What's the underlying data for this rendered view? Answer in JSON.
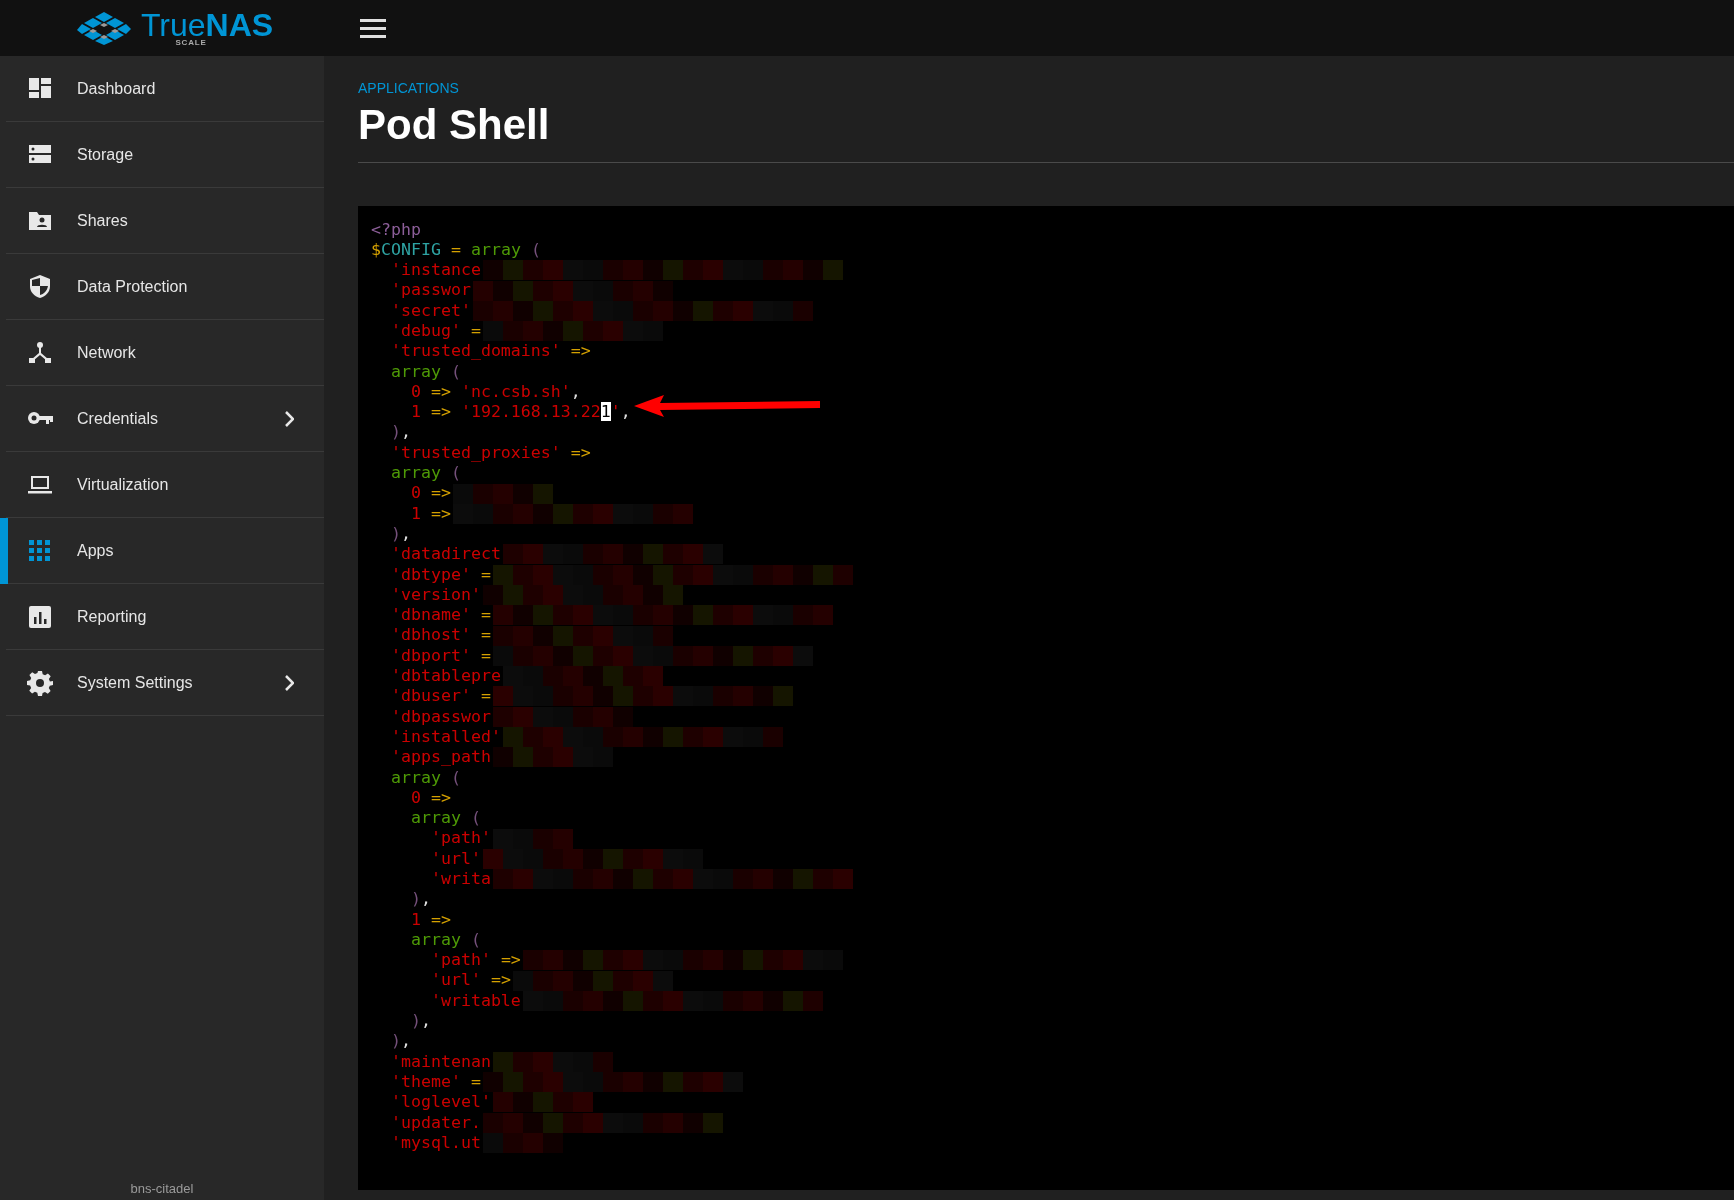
{
  "header": {
    "logo_text": "True**NAS**",
    "logo_subtitle": "SCALE"
  },
  "sidebar": {
    "items": [
      {
        "label": "Dashboard",
        "selected": false,
        "has_submenu": false
      },
      {
        "label": "Storage",
        "selected": false,
        "has_submenu": false
      },
      {
        "label": "Shares",
        "selected": false,
        "has_submenu": false
      },
      {
        "label": "Data Protection",
        "selected": false,
        "has_submenu": false
      },
      {
        "label": "Network",
        "selected": false,
        "has_submenu": false
      },
      {
        "label": "Credentials",
        "selected": false,
        "has_submenu": true
      },
      {
        "label": "Virtualization",
        "selected": false,
        "has_submenu": false
      },
      {
        "label": "Apps",
        "selected": true,
        "has_submenu": false
      },
      {
        "label": "Reporting",
        "selected": false,
        "has_submenu": false
      },
      {
        "label": "System Settings",
        "selected": false,
        "has_submenu": true
      }
    ],
    "hostname": "bns-citadel"
  },
  "page": {
    "breadcrumb": "APPLICATIONS",
    "title": "Pod Shell"
  },
  "terminal": {
    "lines": [
      {
        "tokens": [
          {
            "kind": "tag",
            "text": "<?php"
          }
        ],
        "redacted": false
      },
      {
        "tokens": [
          {
            "kind": "dollar",
            "text": "$"
          },
          {
            "kind": "var",
            "text": "CONFIG"
          },
          {
            "kind": "op",
            "text": " = "
          },
          {
            "kind": "keyword",
            "text": "array"
          },
          {
            "kind": "paren",
            "text": " ("
          }
        ],
        "redacted": false
      },
      {
        "tokens": [
          {
            "kind": "string",
            "text": "  'instance"
          }
        ],
        "redacted": true
      },
      {
        "tokens": [
          {
            "kind": "string",
            "text": "  'passwor"
          }
        ],
        "redacted": true
      },
      {
        "tokens": [
          {
            "kind": "string",
            "text": "  'secret'"
          }
        ],
        "redacted": true
      },
      {
        "tokens": [
          {
            "kind": "string",
            "text": "  'debug'"
          },
          {
            "kind": "op",
            "text": " ="
          }
        ],
        "redacted": true
      },
      {
        "tokens": [
          {
            "kind": "string",
            "text": "  'trusted_domains'"
          },
          {
            "kind": "op",
            "text": " =>"
          }
        ],
        "redacted": false
      },
      {
        "tokens": [
          {
            "kind": "keyword",
            "text": "  array"
          },
          {
            "kind": "paren",
            "text": " ("
          }
        ],
        "redacted": false
      },
      {
        "tokens": [
          {
            "kind": "string",
            "text": "    0"
          },
          {
            "kind": "op",
            "text": " => "
          },
          {
            "kind": "string",
            "text": "'nc.csb.sh'"
          },
          {
            "kind": "punct",
            "text": ","
          }
        ],
        "redacted": false
      },
      {
        "tokens": [
          {
            "kind": "string",
            "text": "    1"
          },
          {
            "kind": "op",
            "text": " => "
          },
          {
            "kind": "string",
            "text": "'192.168.13.22"
          },
          {
            "kind": "cursor",
            "text": "1"
          },
          {
            "kind": "string",
            "text": "'"
          },
          {
            "kind": "punct",
            "text": ","
          }
        ],
        "redacted": false
      },
      {
        "tokens": [
          {
            "kind": "paren",
            "text": "  )"
          },
          {
            "kind": "punct",
            "text": ","
          }
        ],
        "redacted": false
      },
      {
        "tokens": [
          {
            "kind": "string",
            "text": "  'trusted_proxies'"
          },
          {
            "kind": "op",
            "text": " =>"
          }
        ],
        "redacted": false
      },
      {
        "tokens": [
          {
            "kind": "keyword",
            "text": "  array"
          },
          {
            "kind": "paren",
            "text": " ("
          }
        ],
        "redacted": false
      },
      {
        "tokens": [
          {
            "kind": "string",
            "text": "    0"
          },
          {
            "kind": "op",
            "text": " =>"
          }
        ],
        "redacted": true
      },
      {
        "tokens": [
          {
            "kind": "string",
            "text": "    1"
          },
          {
            "kind": "op",
            "text": " =>"
          }
        ],
        "redacted": true
      },
      {
        "tokens": [
          {
            "kind": "paren",
            "text": "  )"
          },
          {
            "kind": "punct",
            "text": ","
          }
        ],
        "redacted": false
      },
      {
        "tokens": [
          {
            "kind": "string",
            "text": "  'datadirect"
          }
        ],
        "redacted": true
      },
      {
        "tokens": [
          {
            "kind": "string",
            "text": "  'dbtype'"
          },
          {
            "kind": "op",
            "text": " ="
          }
        ],
        "redacted": true
      },
      {
        "tokens": [
          {
            "kind": "string",
            "text": "  'version'"
          }
        ],
        "redacted": true
      },
      {
        "tokens": [
          {
            "kind": "string",
            "text": "  'dbname'"
          },
          {
            "kind": "op",
            "text": " ="
          }
        ],
        "redacted": true
      },
      {
        "tokens": [
          {
            "kind": "string",
            "text": "  'dbhost'"
          },
          {
            "kind": "op",
            "text": " ="
          }
        ],
        "redacted": true
      },
      {
        "tokens": [
          {
            "kind": "string",
            "text": "  'dbport'"
          },
          {
            "kind": "op",
            "text": " ="
          }
        ],
        "redacted": true
      },
      {
        "tokens": [
          {
            "kind": "string",
            "text": "  'dbtablepre"
          }
        ],
        "redacted": true
      },
      {
        "tokens": [
          {
            "kind": "string",
            "text": "  'dbuser'"
          },
          {
            "kind": "op",
            "text": " ="
          }
        ],
        "redacted": true
      },
      {
        "tokens": [
          {
            "kind": "string",
            "text": "  'dbpasswor"
          }
        ],
        "redacted": true
      },
      {
        "tokens": [
          {
            "kind": "string",
            "text": "  'installed'"
          }
        ],
        "redacted": true
      },
      {
        "tokens": [
          {
            "kind": "string",
            "text": "  'apps_path"
          }
        ],
        "redacted": true
      },
      {
        "tokens": [
          {
            "kind": "keyword",
            "text": "  array"
          },
          {
            "kind": "paren",
            "text": " ("
          }
        ],
        "redacted": false
      },
      {
        "tokens": [
          {
            "kind": "string",
            "text": "    0"
          },
          {
            "kind": "op",
            "text": " =>"
          }
        ],
        "redacted": false
      },
      {
        "tokens": [
          {
            "kind": "keyword",
            "text": "    array"
          },
          {
            "kind": "paren",
            "text": " ("
          }
        ],
        "redacted": false
      },
      {
        "tokens": [
          {
            "kind": "string",
            "text": "      'path'"
          }
        ],
        "redacted": true
      },
      {
        "tokens": [
          {
            "kind": "string",
            "text": "      'url'"
          }
        ],
        "redacted": true
      },
      {
        "tokens": [
          {
            "kind": "string",
            "text": "      'writa"
          }
        ],
        "redacted": true
      },
      {
        "tokens": [
          {
            "kind": "paren",
            "text": "    )"
          },
          {
            "kind": "punct",
            "text": ","
          }
        ],
        "redacted": false
      },
      {
        "tokens": [
          {
            "kind": "string",
            "text": "    1"
          },
          {
            "kind": "op",
            "text": " =>"
          }
        ],
        "redacted": false
      },
      {
        "tokens": [
          {
            "kind": "keyword",
            "text": "    array"
          },
          {
            "kind": "paren",
            "text": " ("
          }
        ],
        "redacted": false
      },
      {
        "tokens": [
          {
            "kind": "string",
            "text": "      'path'"
          },
          {
            "kind": "op",
            "text": " =>"
          }
        ],
        "redacted": true
      },
      {
        "tokens": [
          {
            "kind": "string",
            "text": "      'url'"
          },
          {
            "kind": "op",
            "text": " =>"
          }
        ],
        "redacted": true
      },
      {
        "tokens": [
          {
            "kind": "string",
            "text": "      'writable"
          }
        ],
        "redacted": true
      },
      {
        "tokens": [
          {
            "kind": "paren",
            "text": "    )"
          },
          {
            "kind": "punct",
            "text": ","
          }
        ],
        "redacted": false
      },
      {
        "tokens": [
          {
            "kind": "paren",
            "text": "  )"
          },
          {
            "kind": "punct",
            "text": ","
          }
        ],
        "redacted": false
      },
      {
        "tokens": [
          {
            "kind": "string",
            "text": "  'maintenan"
          }
        ],
        "redacted": true
      },
      {
        "tokens": [
          {
            "kind": "string",
            "text": "  'theme'"
          },
          {
            "kind": "op",
            "text": " ="
          }
        ],
        "redacted": true
      },
      {
        "tokens": [
          {
            "kind": "string",
            "text": "  'loglevel'"
          }
        ],
        "redacted": true
      },
      {
        "tokens": [
          {
            "kind": "string",
            "text": "  'updater."
          }
        ],
        "redacted": true
      },
      {
        "tokens": [
          {
            "kind": "string",
            "text": "  'mysql.ut"
          }
        ],
        "redacted": true
      }
    ]
  }
}
